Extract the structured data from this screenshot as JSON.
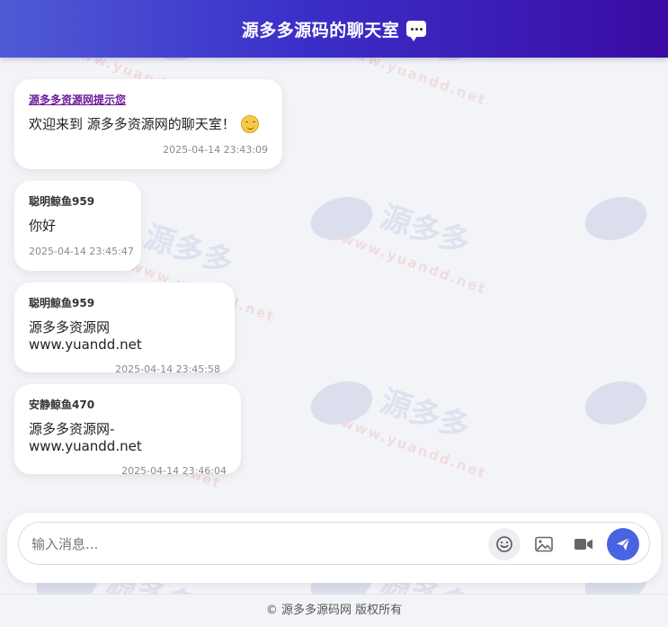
{
  "header": {
    "title": "源多多源码的聊天室",
    "icon": "speech-bubble-icon"
  },
  "messages": [
    {
      "sender": "源多多资源网提示您",
      "text": "欢迎来到 源多多资源网的聊天室！",
      "time": "2025-04-14 23:43:09",
      "system": true,
      "emoji": "smiling-face-icon"
    },
    {
      "sender": "聪明鲸鱼959",
      "text": "你好",
      "time": "2025-04-14 23:45:47"
    },
    {
      "sender": "聪明鲸鱼959",
      "text": "源多多资源网www.yuandd.net",
      "time": "2025-04-14 23:45:58"
    },
    {
      "sender": "安静鲸鱼470",
      "text": "源多多资源网-www.yuandd.net",
      "time": "2025-04-14 23:46:04"
    }
  ],
  "composer": {
    "placeholder": "输入消息...",
    "value": "",
    "icons": [
      "smile-icon",
      "image-icon",
      "video-icon",
      "send-icon"
    ]
  },
  "watermark": {
    "brand": "源多多",
    "url": "www.yuandd.net"
  },
  "footer": {
    "text": "© 源多多源码网 版权所有"
  },
  "colors": {
    "accent": "#4a63e0",
    "header_start": "#4f5bd5",
    "header_end": "#3a0ca3",
    "system_sender": "#6a1b9a"
  }
}
